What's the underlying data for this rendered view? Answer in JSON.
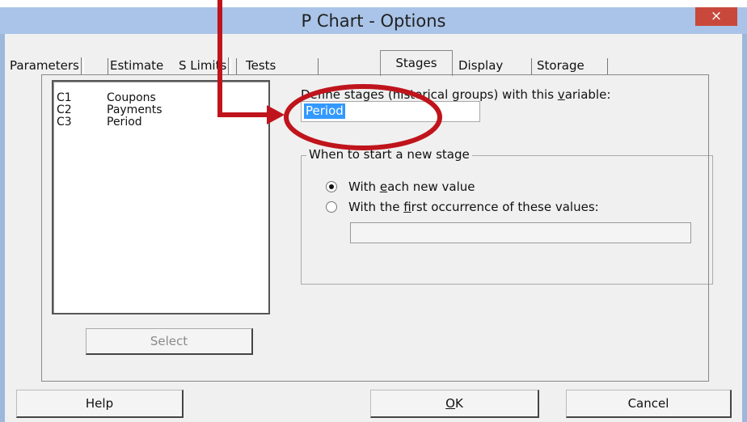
{
  "window": {
    "title": "P Chart - Options",
    "close_glyph": "×"
  },
  "tabs": [
    {
      "label": "Parameters"
    },
    {
      "label": "Estimate"
    },
    {
      "label": "S Limits"
    },
    {
      "label": "Tests"
    },
    {
      "label": "Stages",
      "active": true
    },
    {
      "label": "Display"
    },
    {
      "label": "Storage"
    }
  ],
  "variables": [
    {
      "code": "C1",
      "name": "Coupons"
    },
    {
      "code": "C2",
      "name": "Payments"
    },
    {
      "code": "C3",
      "name": "Period"
    }
  ],
  "select_button": {
    "label": "Select",
    "enabled": false
  },
  "define_stages": {
    "label_pre": "Define stages (historical groups) with this ",
    "label_u": "v",
    "label_post": "ariable:",
    "value": "Period"
  },
  "new_stage_group": {
    "title": "When to start a new stage",
    "options": [
      {
        "pre": "With ",
        "u": "e",
        "post": "ach new value",
        "selected": true
      },
      {
        "pre": "With the ",
        "u": "f",
        "post": "irst occurrence of these values:",
        "selected": false
      }
    ],
    "values_field": ""
  },
  "buttons": {
    "help": "Help",
    "ok_u": "O",
    "ok_post": "K",
    "cancel": "Cancel"
  },
  "annotation": {
    "color": "#c0141c"
  }
}
